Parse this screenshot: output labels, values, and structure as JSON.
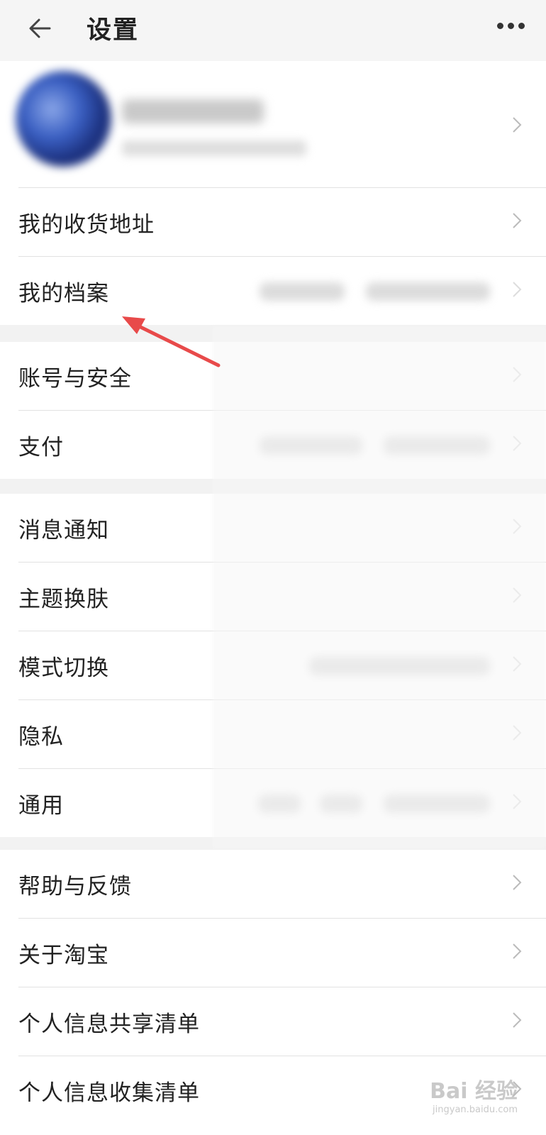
{
  "header": {
    "title": "设置",
    "back_icon": "arrow-left-icon",
    "more_icon": "more-dots-icon"
  },
  "groups": [
    {
      "items": [
        {
          "label": "我的收货地址"
        },
        {
          "label": "我的档案"
        }
      ]
    },
    {
      "items": [
        {
          "label": "账号与安全"
        },
        {
          "label": "支付"
        }
      ]
    },
    {
      "items": [
        {
          "label": "消息通知"
        },
        {
          "label": "主题换肤"
        },
        {
          "label": "模式切换"
        },
        {
          "label": "隐私"
        },
        {
          "label": "通用"
        }
      ]
    },
    {
      "items": [
        {
          "label": "帮助与反馈"
        },
        {
          "label": "关于淘宝"
        },
        {
          "label": "个人信息共享清单"
        },
        {
          "label": "个人信息收集清单"
        }
      ]
    }
  ],
  "watermark": {
    "text": "Bai 经验",
    "sub": "jingyan.baidu.com"
  },
  "colors": {
    "annotation_arrow": "#e84a4a",
    "background": "#f2f2f2"
  }
}
